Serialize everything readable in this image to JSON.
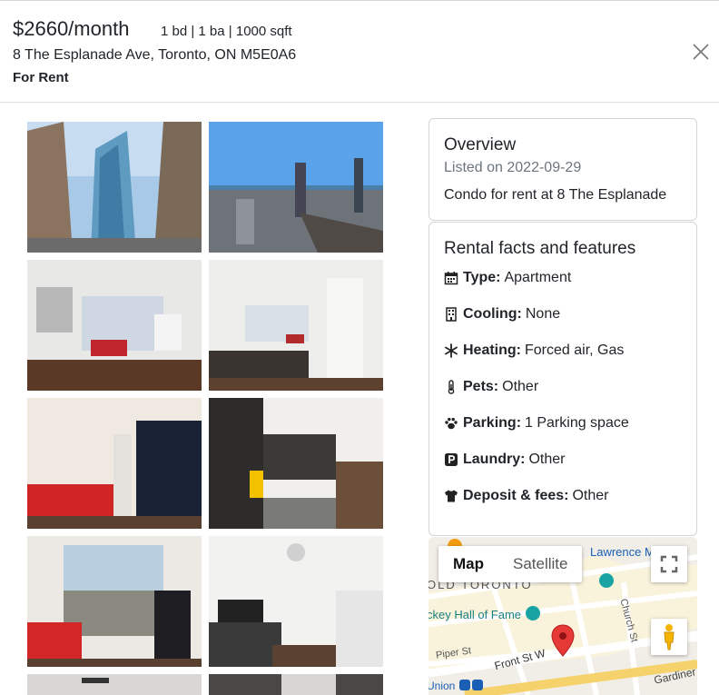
{
  "listing": {
    "price": "$2660/month",
    "specs": "1 bd | 1 ba | 1000 sqft",
    "address": "8 The Esplanade Ave, Toronto, ON M5E0A6",
    "status": "For Rent"
  },
  "overview": {
    "title": "Overview",
    "listed": "Listed on 2022-09-29",
    "description": "Condo for rent at 8 The Esplanade"
  },
  "facts": {
    "title": "Rental facts and features",
    "items": [
      {
        "label": "Type:",
        "value": "Apartment",
        "icon": "calendar-icon"
      },
      {
        "label": "Cooling:",
        "value": "None",
        "icon": "building-icon"
      },
      {
        "label": "Heating:",
        "value": "Forced air, Gas",
        "icon": "snowflake-icon"
      },
      {
        "label": "Pets:",
        "value": "Other",
        "icon": "thermometer-icon"
      },
      {
        "label": "Parking:",
        "value": "1 Parking space",
        "icon": "paw-icon"
      },
      {
        "label": "Laundry:",
        "value": "Other",
        "icon": "parking-icon"
      },
      {
        "label": "Deposit & fees:",
        "value": "Other",
        "icon": "shirt-icon"
      }
    ]
  },
  "map": {
    "map_label": "Map",
    "satellite_label": "Satellite",
    "labels": {
      "lawrence": "Lawrence M",
      "toronto": "OLD TORONTO",
      "hall_of_fame": "ckey Hall of Fame",
      "church": "Church St",
      "piper": "Piper St",
      "front": "Front St W",
      "union": "Union",
      "gardiner": "Gardiner"
    }
  },
  "colors": {
    "text": "#212529",
    "muted": "#6c757d",
    "map_pin": "#e53935",
    "pegman": "#f5b400"
  }
}
